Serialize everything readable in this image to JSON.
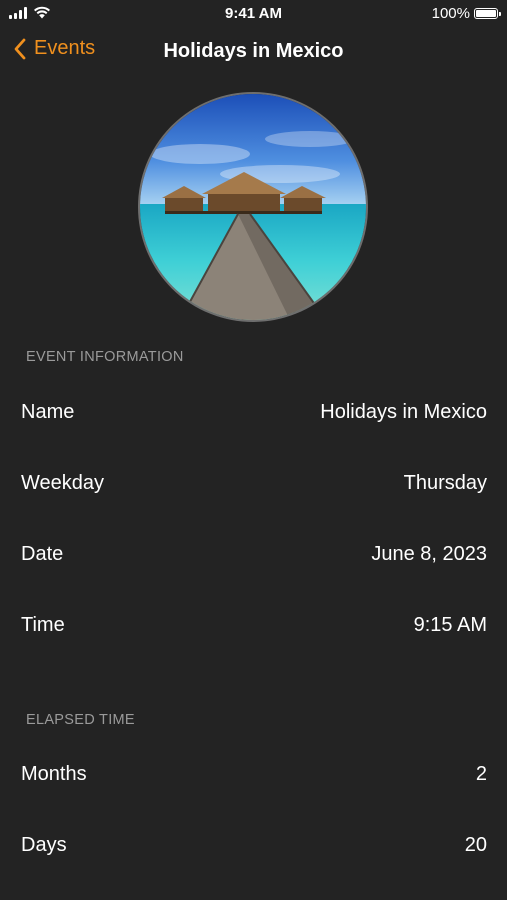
{
  "status_bar": {
    "time": "9:41 AM",
    "battery_percent": "100%",
    "battery_level": 1.0
  },
  "nav": {
    "back_label": "Events",
    "title": "Holidays in Mexico"
  },
  "sections": {
    "event_info": {
      "header": "EVENT INFORMATION",
      "rows": [
        {
          "label": "Name",
          "value": "Holidays in Mexico"
        },
        {
          "label": "Weekday",
          "value": "Thursday"
        },
        {
          "label": "Date",
          "value": "June 8, 2023"
        },
        {
          "label": "Time",
          "value": "9:15 AM"
        }
      ]
    },
    "elapsed": {
      "header": "ELAPSED TIME",
      "rows": [
        {
          "label": "Months",
          "value": "2"
        },
        {
          "label": "Days",
          "value": "20"
        }
      ]
    }
  },
  "colors": {
    "background": "#232323",
    "accent": "#f0901e",
    "section_header": "#9a9a9a"
  },
  "icons": {
    "back": "chevron-left-icon",
    "signal": "cellular-signal-icon",
    "wifi": "wifi-icon",
    "battery": "battery-icon"
  }
}
